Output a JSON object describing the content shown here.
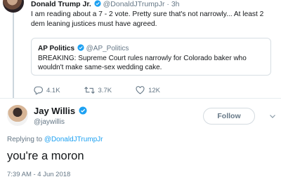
{
  "parent_tweet": {
    "name": "Donald Trump Jr.",
    "handle": "@DonaldJTrumpJr",
    "separator": "·",
    "time": "3h",
    "text": "I am reading about a 7 - 2 vote. Pretty sure that's not narrowly... At least 2 dem leaning justices must have agreed.",
    "verified": true,
    "quoted": {
      "name": "AP Politics",
      "handle": "@AP_Politics",
      "verified": true,
      "text": "BREAKING: Supreme Court rules narrowly for Colorado baker who wouldn't make same-sex wedding cake."
    },
    "actions": {
      "replies": "4.1K",
      "retweets": "3.7K",
      "likes": "12K"
    }
  },
  "main_tweet": {
    "name": "Jay Willis",
    "handle": "@jaywillis",
    "verified": true,
    "follow_label": "Follow",
    "replying_label": "Replying to",
    "replying_handle": "@DonaldJTrumpJr",
    "text": "you're a moron",
    "timestamp": "7:39 AM - 4 Jun 2018"
  },
  "colors": {
    "accent": "#1da1f2",
    "secondary_text": "#657786",
    "border": "#e6ecf0"
  }
}
